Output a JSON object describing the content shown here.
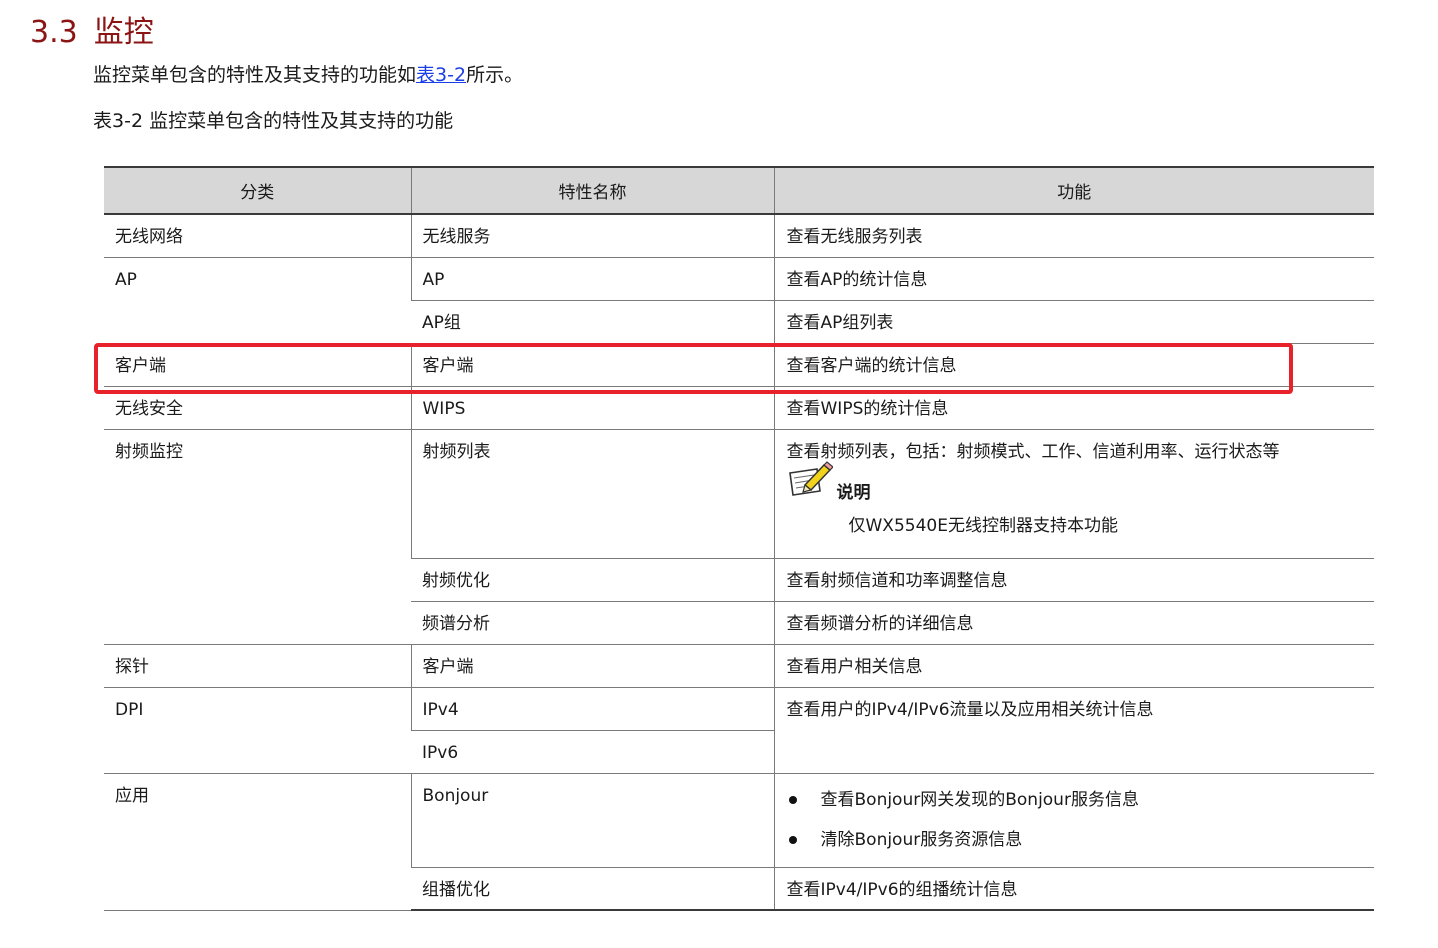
{
  "section": {
    "number": "3.3",
    "title": "监控"
  },
  "intro": {
    "before": "监控菜单包含的特性及其支持的功能如",
    "link": "表3-2",
    "after": "所示。"
  },
  "caption": "表3-2 监控菜单包含的特性及其支持的功能",
  "table": {
    "headers": [
      "分类",
      "特性名称",
      "功能"
    ],
    "rows": [
      {
        "category": "无线网络",
        "feature": "无线服务",
        "function": "查看无线服务列表"
      },
      {
        "category": "AP",
        "feature": "AP",
        "function": "查看AP的统计信息"
      },
      {
        "feature": "AP组",
        "function": "查看AP组列表"
      },
      {
        "category": "客户端",
        "feature": "客户端",
        "function": "查看客户端的统计信息"
      },
      {
        "category": "无线安全",
        "feature": "WIPS",
        "function": "查看WIPS的统计信息"
      },
      {
        "category": "射频监控",
        "feature": "射频列表",
        "function": "查看射频列表，包括：射频模式、工作、信道利用率、运行状态等",
        "note": {
          "label": "说明",
          "text": "仅WX5540E无线控制器支持本功能"
        }
      },
      {
        "feature": "射频优化",
        "function": "查看射频信道和功率调整信息"
      },
      {
        "feature": "频谱分析",
        "function": "查看频谱分析的详细信息"
      },
      {
        "category": "探针",
        "feature": "客户端",
        "function": "查看用户相关信息"
      },
      {
        "category": "DPI",
        "feature": "IPv4",
        "function": "查看用户的IPv4/IPv6流量以及应用相关统计信息"
      },
      {
        "feature": "IPv6"
      },
      {
        "category": "应用",
        "feature": "Bonjour",
        "bullets": [
          "查看Bonjour网关发现的Bonjour服务信息",
          "清除Bonjour服务资源信息"
        ]
      },
      {
        "feature": "组播优化",
        "function": "查看IPv4/IPv6的组播统计信息"
      }
    ]
  },
  "highlight": {
    "color": "#e8222a"
  },
  "icons": {
    "note": "note-pencil-icon"
  }
}
